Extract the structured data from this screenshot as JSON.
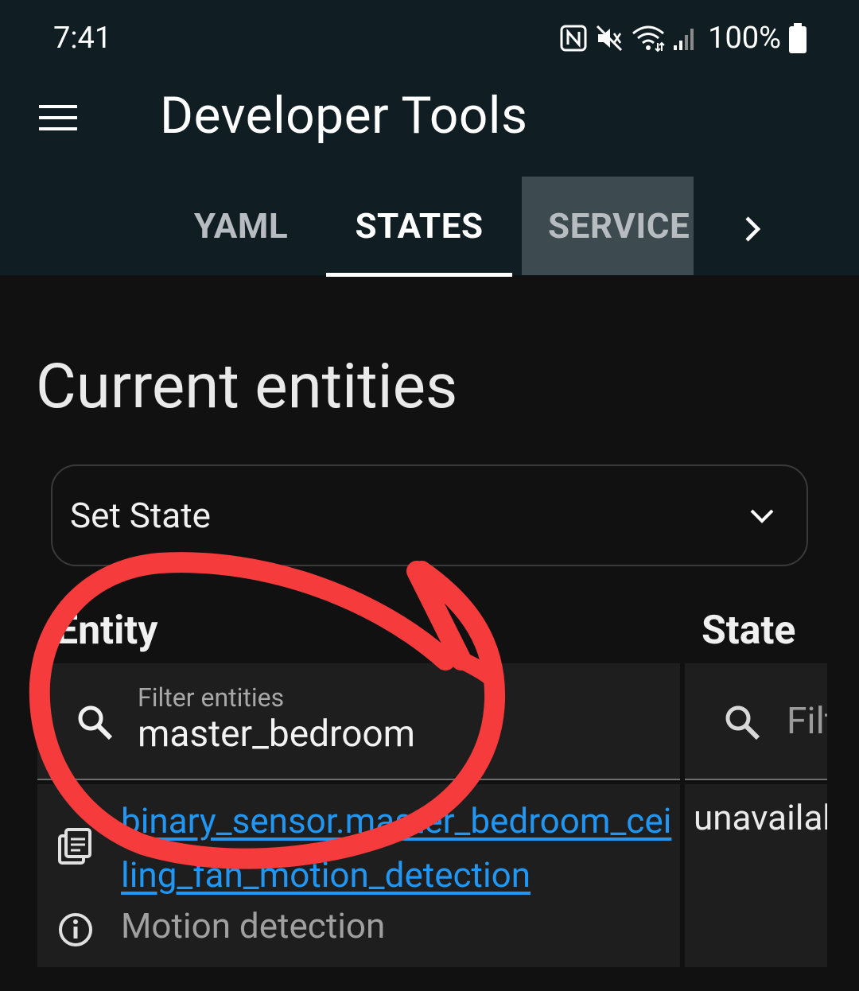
{
  "status_bar": {
    "time": "7:41",
    "battery": "100%",
    "icons": [
      "nfc-icon",
      "mute-icon",
      "wifi-icon",
      "signal-icon",
      "battery-icon"
    ]
  },
  "header": {
    "title": "Developer Tools",
    "menu_icon": "hamburger-menu-icon"
  },
  "tabs": [
    {
      "label": "YAML",
      "active": false
    },
    {
      "label": "STATES",
      "active": true
    },
    {
      "label": "SERVICE",
      "active": false
    }
  ],
  "main": {
    "section_title": "Current entities",
    "set_state_label": "Set State",
    "columns": {
      "entity": "Entity",
      "state": "State"
    },
    "filters": {
      "entity_label": "Filter entities",
      "entity_value": "master_bedroom",
      "state_placeholder": "Filter states"
    },
    "rows": [
      {
        "entity_id": "binary_sensor.master_bedroom_ceiling_fan_motion_detection",
        "friendly_name": "Motion detection",
        "state": "unavailable"
      }
    ]
  },
  "colors": {
    "header_bg": "#101e24",
    "page_bg": "#111111",
    "link": "#2196f3",
    "annotation": "#f53b3b"
  }
}
